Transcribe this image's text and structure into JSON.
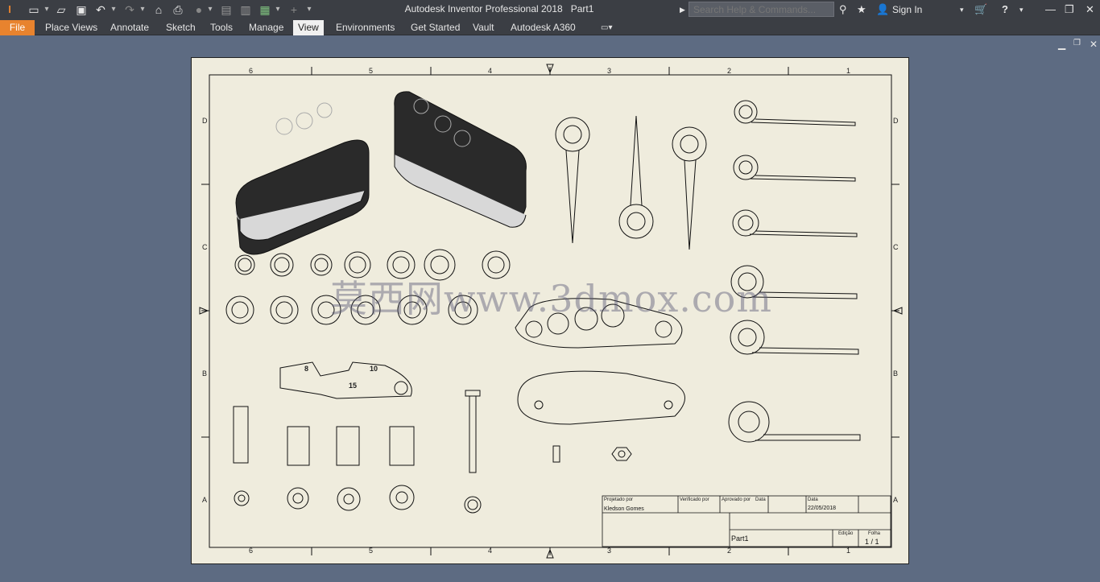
{
  "titlebar": {
    "app_title": "Autodesk Inventor Professional 2018",
    "document": "Part1",
    "search_placeholder": "Search Help & Commands...",
    "sign_in": "Sign In"
  },
  "menu": {
    "file": "File",
    "items": [
      "Place Views",
      "Annotate",
      "Sketch",
      "Tools",
      "Manage",
      "View",
      "Environments",
      "Get Started",
      "Vault",
      "Autodesk A360"
    ],
    "active": "View"
  },
  "sheet": {
    "zones_top": [
      "6",
      "5",
      "4",
      "3",
      "2",
      "1"
    ],
    "zones_side": [
      "D",
      "C",
      "B",
      "A"
    ],
    "text_labels": [
      "8",
      "10",
      "15"
    ],
    "title_block": {
      "designed_by_label": "Projetado por",
      "designed_by": "Kledson Gomes",
      "checked_by_label": "Verificado por",
      "approved_by_label": "Aprovado por",
      "date_label1": "Data",
      "date_label2": "Data",
      "date": "22/05/2018",
      "part": "Part1",
      "edition_label": "Edição",
      "sheet_label": "Folha",
      "sheet": "1 / 1"
    }
  },
  "watermark": "莫西网www.3dmox.com",
  "colors": {
    "file_tab": "#e8832e",
    "background": "#5d6b82",
    "sheet": "#efecdd",
    "chrome": "#3b3e44"
  }
}
